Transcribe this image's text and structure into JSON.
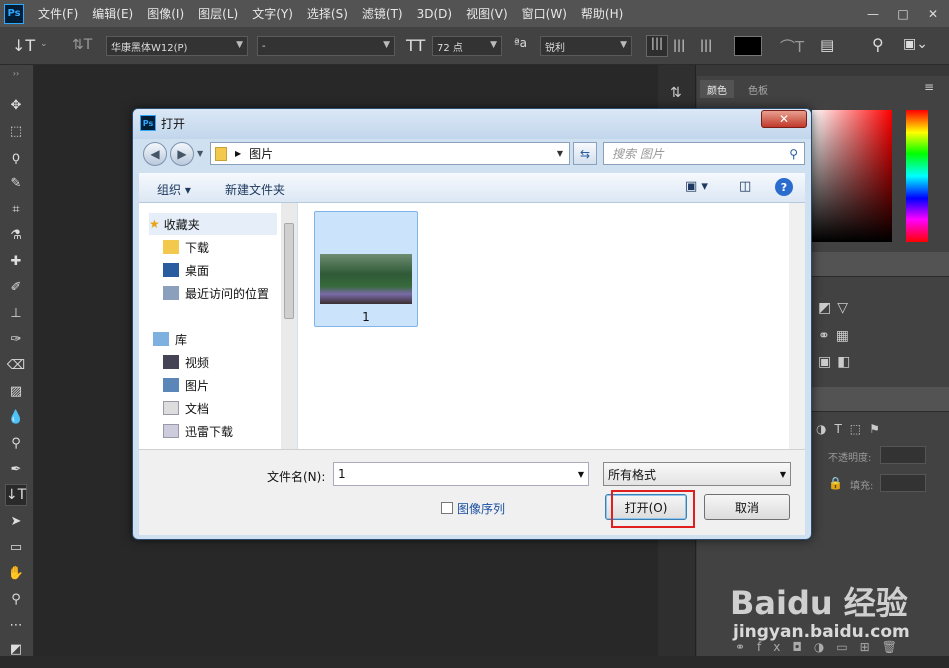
{
  "app": {
    "logo": "Ps"
  },
  "menu": [
    "文件(F)",
    "编辑(E)",
    "图像(I)",
    "图层(L)",
    "文字(Y)",
    "选择(S)",
    "滤镜(T)",
    "3D(D)",
    "视图(V)",
    "窗口(W)",
    "帮助(H)"
  ],
  "window_controls": {
    "minimize": "—",
    "maximize": "□",
    "close": "✕"
  },
  "options": {
    "font_family": "华康黑体W12(P)",
    "font_style": "-",
    "font_size": "72 点",
    "antialias": "锐利"
  },
  "panels": {
    "tabs": [
      "颜色",
      "色板"
    ],
    "opacity_label": "不透明度:",
    "fill_label": "填充:"
  },
  "dialog": {
    "title": "打开",
    "close_label": "✕",
    "address": "图片",
    "search_placeholder": "搜索 图片",
    "cmd_organize": "组织 ▾",
    "cmd_new_folder": "新建文件夹",
    "help_label": "?",
    "nav": {
      "favorites": "收藏夹",
      "items": [
        "下载",
        "桌面",
        "最近访问的位置"
      ],
      "library": "库",
      "lib_items": [
        "视频",
        "图片",
        "文档",
        "迅雷下载"
      ]
    },
    "files": [
      {
        "name": "1"
      }
    ],
    "filename_label": "文件名(N):",
    "filename_value": "1",
    "format_value": "所有格式",
    "sequence_label": "图像序列",
    "open_label": "打开(O)",
    "cancel_label": "取消"
  },
  "watermark": {
    "line1": "Baidu 经验",
    "line2": "jingyan.baidu.com"
  },
  "colors": {
    "accent": "#31a8ff",
    "highlight": "#e02020"
  }
}
